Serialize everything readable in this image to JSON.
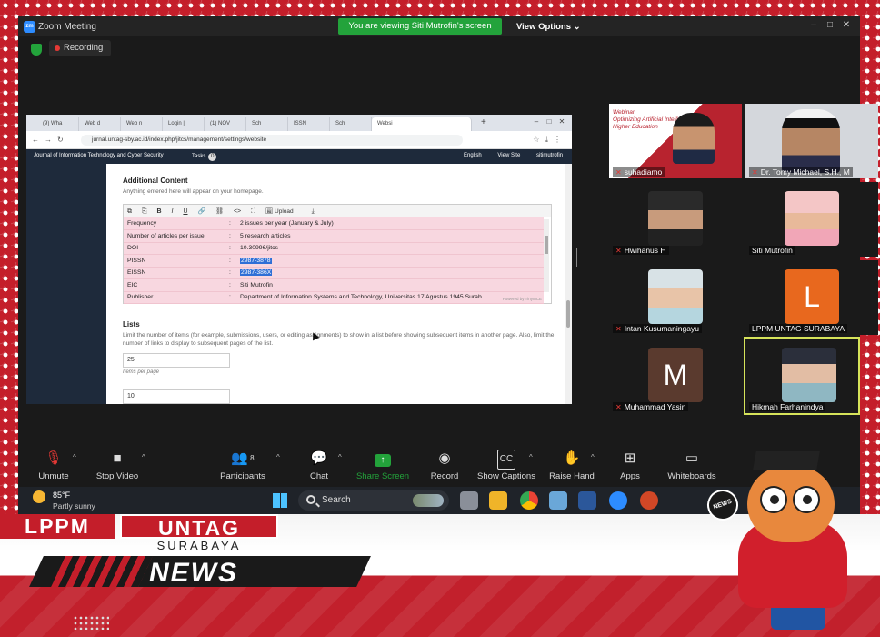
{
  "zoom": {
    "window_title": "Zoom Meeting",
    "viewing_banner": "You are viewing Siti Mutrofin's screen",
    "view_options": "View Options",
    "recording": "Recording"
  },
  "browser": {
    "tabs": [
      {
        "label": "(9) Wha"
      },
      {
        "label": "Web d"
      },
      {
        "label": "Web n"
      },
      {
        "label": "Login |"
      },
      {
        "label": "(1) NOV"
      },
      {
        "label": "Sch"
      },
      {
        "label": "ISSN"
      },
      {
        "label": "Sch"
      },
      {
        "label": "Websi"
      }
    ],
    "url": "jurnal.untag-sby.ac.id/index.php/jitcs/management/settings/website",
    "journal_name": "Journal of Information Technology and Cyber Security",
    "tasks_label": "Tasks",
    "tasks_count": "0",
    "language": "English",
    "view_site": "View Site",
    "user": "sitimutrofin"
  },
  "settings": {
    "additional_title": "Additional Content",
    "additional_desc": "Anything entered here will appear on your homepage.",
    "upload_label": "Upload",
    "table_rows": [
      {
        "key": "Frequency",
        "value": "2 issues per year (January & July)"
      },
      {
        "key": "Number of articles per issue",
        "value": "5 research articles"
      },
      {
        "key": "DOI",
        "value": "10.30996/jitcs"
      },
      {
        "key": "PISSN",
        "value": "2987-3878"
      },
      {
        "key": "EISSN",
        "value": "2987-386X"
      },
      {
        "key": "EIC",
        "value": "Siti Mutrofin"
      },
      {
        "key": "Publisher",
        "value": "Department of Information Systems and Technology, Universitas 17 Agustus 1945 Surab"
      }
    ],
    "editor_footer": "Powered by TinyMCE",
    "lists_title": "Lists",
    "lists_desc": "Limit the number of items (for example, submissions, users, or editing assignments) to show in a list before showing subsequent items in another page. Also, limit the number of links to display to subsequent pages of the list.",
    "items_per_page_value": "25",
    "items_per_page_label": "Items per page",
    "links_value": "10"
  },
  "participants": [
    {
      "name": "suhadiamo",
      "muted": true
    },
    {
      "name": "Dr. Tomy Michael, S.H., M",
      "muted": true
    },
    {
      "name": "Hwihanus H",
      "muted": true
    },
    {
      "name": "Siti Mutrofin",
      "muted": false
    },
    {
      "name": "Intan Kusumaningayu",
      "muted": true
    },
    {
      "name": "LPPM UNTAG SURABAYA",
      "muted": false,
      "letter": "L",
      "color": "#e8681e"
    },
    {
      "name": "Muhammad Yasin",
      "muted": true,
      "letter": "M",
      "color": "#5a3a2e"
    },
    {
      "name": "Hikmah Farhanindya",
      "muted": false
    }
  ],
  "slide": {
    "line1": "Webinar",
    "line2": "Optimizing Artificial Intelligence",
    "line3": "Higher Education"
  },
  "toolbar": {
    "unmute": "Unmute",
    "stop_video": "Stop Video",
    "participants": "Participants",
    "participants_count": "8",
    "chat": "Chat",
    "share_screen": "Share Screen",
    "record": "Record",
    "show_captions": "Show Captions",
    "raise_hand": "Raise Hand",
    "apps": "Apps",
    "whiteboards": "Whiteboards",
    "cc": "CC"
  },
  "taskbar": {
    "temperature": "85°F",
    "weather": "Partly sunny",
    "search": "Search"
  },
  "branding": {
    "lppm": "LPPM",
    "untag": "UNTAG",
    "surabaya": "SURABAYA",
    "news": "NEWS",
    "mic_text": "NEWS"
  },
  "colors": {
    "brand_red": "#c41e2a",
    "zoom_green": "#23a33b",
    "zoom_blue": "#2d8cff",
    "speaker_highlight": "#d6e35a"
  }
}
